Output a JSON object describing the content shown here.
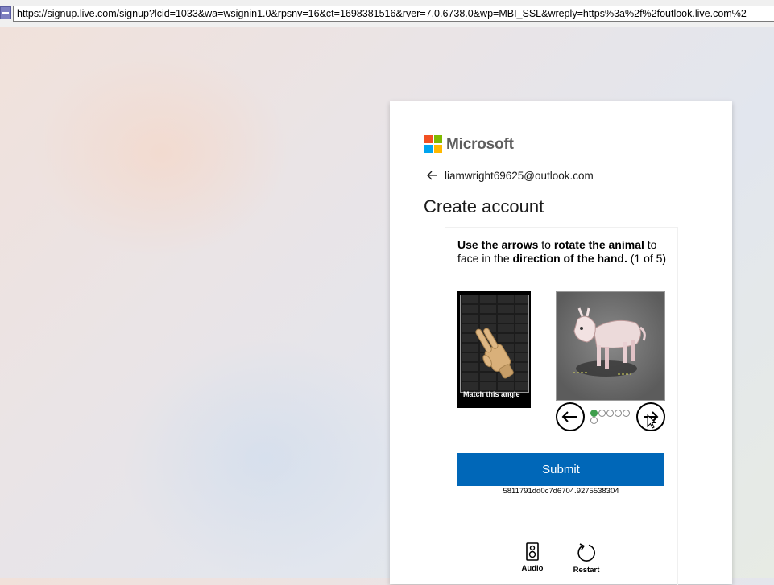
{
  "browser": {
    "url": "https://signup.live.com/signup?lcid=1033&wa=wsignin1.0&rpsnv=16&ct=1698381516&rver=7.0.6738.0&wp=MBI_SSL&wreply=https%3a%2f%2foutlook.live.com%2"
  },
  "brand": {
    "name": "Microsoft",
    "colors": [
      "#f25022",
      "#7fba00",
      "#00a4ef",
      "#ffb900"
    ]
  },
  "account": {
    "back_icon": "arrow-left-icon",
    "email": "liamwright69625@outlook.com"
  },
  "page": {
    "title": "Create account"
  },
  "puzzle": {
    "instruction": {
      "p1": "Use the arrows",
      "p2": " to ",
      "p3": "rotate the animal",
      "p4": " to face in the ",
      "p5": "direction of the hand.",
      "p6": " (1 of 5)"
    },
    "reference_label": "Match this angle",
    "prev_icon": "arrow-left-icon",
    "next_icon": "arrow-right-icon",
    "progress": {
      "current": 1,
      "total": 6
    },
    "submit_label": "Submit",
    "session_code": "5811791dd0c7d6704.9275538304",
    "audio_label": "Audio",
    "restart_label": "Restart",
    "accent": "#0067b8",
    "active_dot_color": "#3f9e4d"
  }
}
